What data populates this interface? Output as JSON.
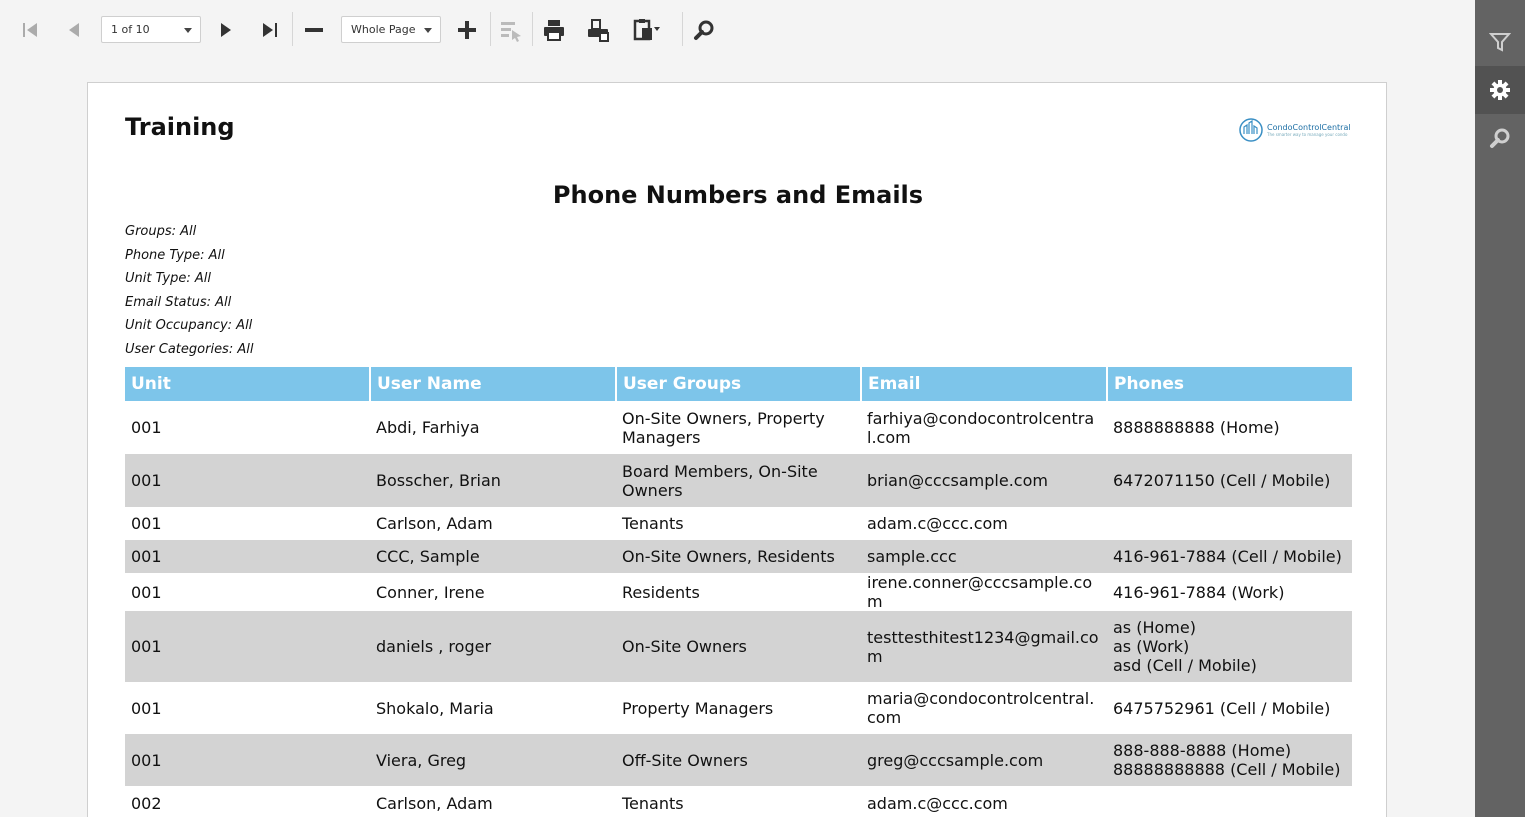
{
  "toolbar": {
    "page_indicator": "1 of 10",
    "zoom_mode": "Whole Page"
  },
  "report": {
    "company_title": "Training",
    "logo_text": "CondoControlCentral",
    "logo_tagline": "The smarter way to manage your condo",
    "title": "Phone Numbers and Emails",
    "filters": [
      "Groups: All",
      "Phone Type: All",
      "Unit Type: All",
      "Email Status: All",
      "Unit Occupancy: All",
      "User Categories: All"
    ]
  },
  "table": {
    "headers": [
      "Unit",
      "User Name",
      "User Groups",
      "Email",
      "Phones"
    ],
    "rows": [
      {
        "unit": "001",
        "name": "Abdi, Farhiya",
        "groups": "On-Site Owners, Property Managers",
        "email": "farhiya@condocontrolcentral.com",
        "phones": [
          "8888888888 (Home)"
        ]
      },
      {
        "unit": "001",
        "name": "Bosscher, Brian",
        "groups": "Board Members, On-Site Owners",
        "email": "brian@cccsample.com",
        "phones": [
          "6472071150 (Cell / Mobile)"
        ]
      },
      {
        "unit": "001",
        "name": "Carlson, Adam",
        "groups": "Tenants",
        "email": "adam.c@ccc.com",
        "phones": []
      },
      {
        "unit": "001",
        "name": "CCC, Sample",
        "groups": "On-Site Owners, Residents",
        "email": "sample.ccc",
        "phones": [
          "416-961-7884 (Cell / Mobile)"
        ]
      },
      {
        "unit": "001",
        "name": "Conner, Irene",
        "groups": "Residents",
        "email": "irene.conner@cccsample.com",
        "phones": [
          "416-961-7884 (Work)"
        ]
      },
      {
        "unit": "001",
        "name": "daniels , roger",
        "groups": "On-Site Owners",
        "email": "testtesthitest1234@gmail.com",
        "phones": [
          "as (Home)",
          "as (Work)",
          "asd (Cell / Mobile)"
        ]
      },
      {
        "unit": "001",
        "name": "Shokalo, Maria",
        "groups": "Property Managers",
        "email": "maria@condocontrolcentral.com",
        "phones": [
          "6475752961 (Cell / Mobile)"
        ]
      },
      {
        "unit": "001",
        "name": "Viera, Greg",
        "groups": "Off-Site Owners",
        "email": "greg@cccsample.com",
        "phones": [
          "888-888-8888 (Home)",
          "88888888888 (Cell / Mobile)"
        ]
      },
      {
        "unit": "002",
        "name": "Carlson, Adam",
        "groups": "Tenants",
        "email": "adam.c@ccc.com",
        "phones": []
      }
    ]
  }
}
